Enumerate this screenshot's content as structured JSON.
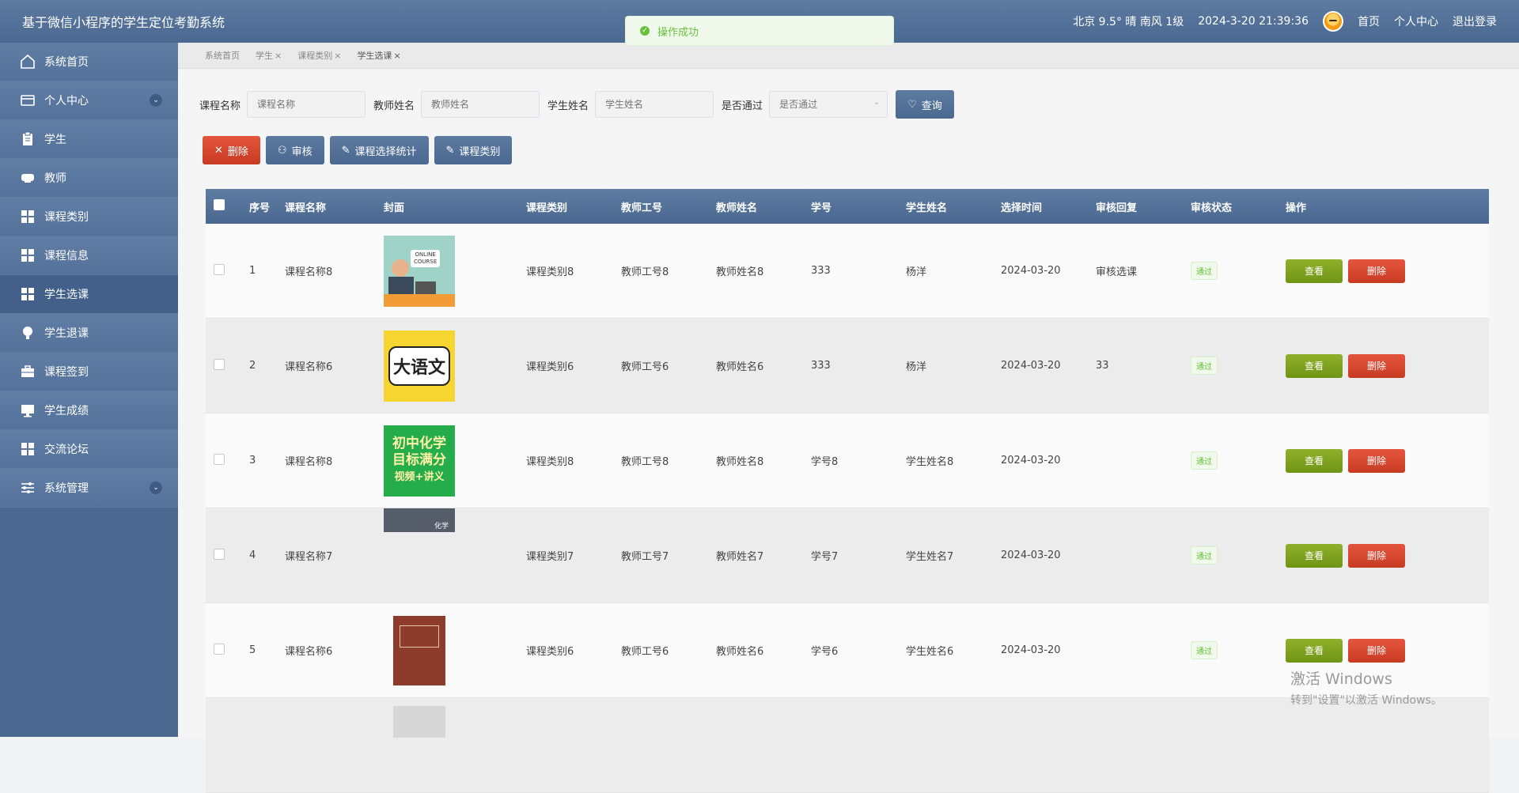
{
  "header": {
    "title": "基于微信小程序的学生定位考勤系统",
    "weather": "北京  9.5°  晴  南风  1级",
    "datetime": "2024-3-20 21:39:36",
    "links": [
      "首页",
      "个人中心",
      "退出登录"
    ]
  },
  "toast": {
    "text": "操作成功"
  },
  "sidebar": {
    "items": [
      {
        "label": "系统首页",
        "icon": "home-icon"
      },
      {
        "label": "个人中心",
        "icon": "card-icon",
        "expandable": true
      },
      {
        "label": "学生",
        "icon": "clipboard-icon"
      },
      {
        "label": "教师",
        "icon": "monitor-icon"
      },
      {
        "label": "课程类别",
        "icon": "grid-icon"
      },
      {
        "label": "课程信息",
        "icon": "grid-icon"
      },
      {
        "label": "学生选课",
        "icon": "grid-icon",
        "active": true
      },
      {
        "label": "学生退课",
        "icon": "bulb-icon"
      },
      {
        "label": "课程签到",
        "icon": "briefcase-icon"
      },
      {
        "label": "学生成绩",
        "icon": "desktop-icon"
      },
      {
        "label": "交流论坛",
        "icon": "grid-icon"
      },
      {
        "label": "系统管理",
        "icon": "sliders-icon",
        "expandable": true
      }
    ]
  },
  "breadcrumb": [
    "系统首页",
    "学生",
    "课程类别",
    "学生选课"
  ],
  "search": {
    "course_label": "课程名称",
    "course_placeholder": "课程名称",
    "teacher_label": "教师姓名",
    "teacher_placeholder": "教师姓名",
    "student_label": "学生姓名",
    "student_placeholder": "学生姓名",
    "pass_label": "是否通过",
    "pass_placeholder": "是否通过",
    "query_label": "查询"
  },
  "actions": {
    "delete": "删除",
    "audit": "审核",
    "stats": "课程选择统计",
    "category": "课程类别"
  },
  "table": {
    "headers": [
      "序号",
      "课程名称",
      "封面",
      "课程类别",
      "教师工号",
      "教师姓名",
      "学号",
      "学生姓名",
      "选择时间",
      "审核回复",
      "审核状态",
      "操作"
    ],
    "view_label": "查看",
    "delete_label": "删除",
    "rows": [
      {
        "idx": "1",
        "name": "课程名称8",
        "cover_text": [
          "ONLINE",
          "COURSE"
        ],
        "category": "课程类别8",
        "tno": "教师工号8",
        "tname": "教师姓名8",
        "sno": "333",
        "sname": "杨洋",
        "time": "2024-03-20",
        "reply": "审核选课",
        "status": "通过"
      },
      {
        "idx": "2",
        "name": "课程名称6",
        "cover_text": [
          "大语文"
        ],
        "category": "课程类别6",
        "tno": "教师工号6",
        "tname": "教师姓名6",
        "sno": "333",
        "sname": "杨洋",
        "time": "2024-03-20",
        "reply": "33",
        "status": "通过"
      },
      {
        "idx": "3",
        "name": "课程名称8",
        "cover_text": [
          "初中化学",
          "目标满分",
          "视频+讲义"
        ],
        "category": "课程类别8",
        "tno": "教师工号8",
        "tname": "教师姓名8",
        "sno": "学号8",
        "sname": "学生姓名8",
        "time": "2024-03-20",
        "reply": "",
        "status": "通过"
      },
      {
        "idx": "4",
        "name": "课程名称7",
        "cover_text": [
          "化学"
        ],
        "category": "课程类别7",
        "tno": "教师工号7",
        "tname": "教师姓名7",
        "sno": "学号7",
        "sname": "学生姓名7",
        "time": "2024-03-20",
        "reply": "",
        "status": "通过"
      },
      {
        "idx": "5",
        "name": "课程名称6",
        "cover_text": [],
        "category": "课程类别6",
        "tno": "教师工号6",
        "tname": "教师姓名6",
        "sno": "学号6",
        "sname": "学生姓名6",
        "time": "2024-03-20",
        "reply": "",
        "status": "通过"
      }
    ]
  },
  "watermark": {
    "line1": "激活 Windows",
    "line2": "转到\"设置\"以激活 Windows。"
  }
}
